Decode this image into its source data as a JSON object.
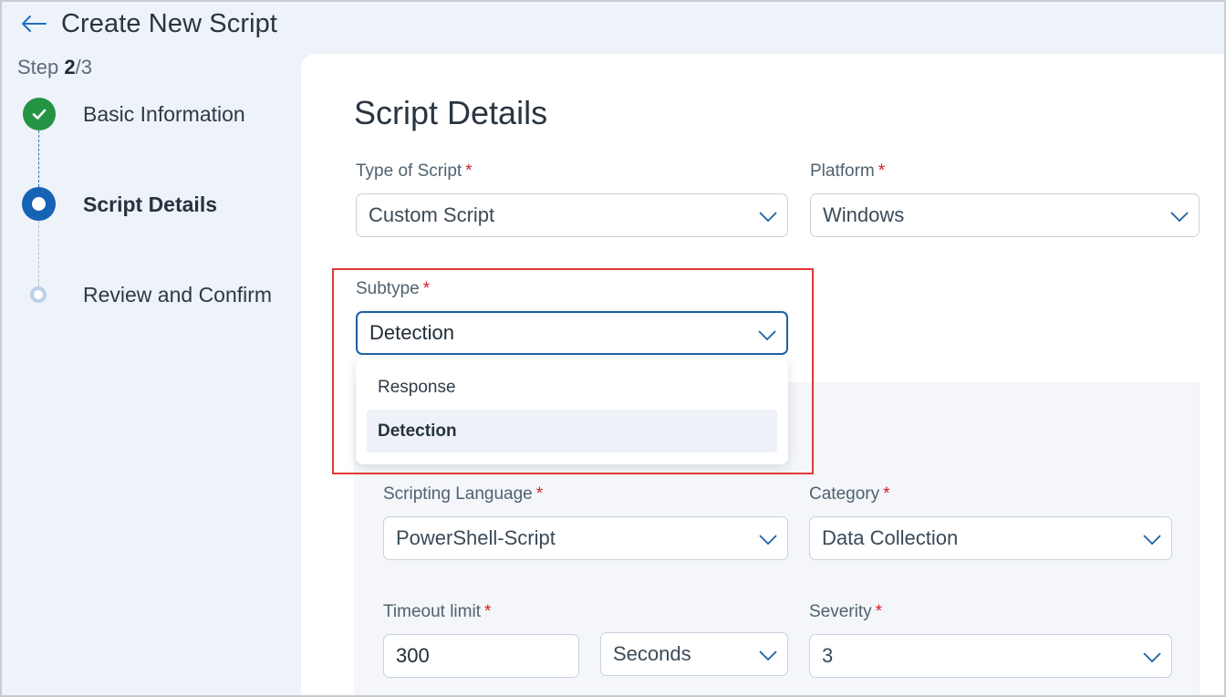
{
  "header": {
    "back_icon": "arrow-left-icon",
    "title": "Create New Script"
  },
  "step_counter": {
    "prefix": "Step ",
    "current": "2",
    "total": "/3"
  },
  "steps": [
    {
      "label": "Basic Information",
      "status": "completed"
    },
    {
      "label": "Script Details",
      "status": "active"
    },
    {
      "label": "Review and Confirm",
      "status": "pending"
    }
  ],
  "section_title": "Script Details",
  "fields": {
    "type_of_script": {
      "label": "Type of Script",
      "required": "*",
      "value": "Custom Script"
    },
    "platform": {
      "label": "Platform",
      "required": "*",
      "value": "Windows"
    },
    "subtype": {
      "label": "Subtype",
      "required": "*",
      "value": "Detection",
      "options": [
        {
          "label": "Response",
          "selected": false
        },
        {
          "label": "Detection",
          "selected": true
        }
      ]
    },
    "scripting_language": {
      "label": "Scripting Language",
      "required": "*",
      "value": "PowerShell-Script"
    },
    "category": {
      "label": "Category",
      "required": "*",
      "value": "Data Collection"
    },
    "timeout_limit": {
      "label": "Timeout limit",
      "required": "*",
      "value": "300",
      "unit": "Seconds"
    },
    "severity": {
      "label": "Severity",
      "required": "*",
      "value": "3"
    }
  },
  "colors": {
    "accent": "#1662b4",
    "success": "#259344",
    "required": "#d0202a",
    "highlight": "#df3b34"
  }
}
